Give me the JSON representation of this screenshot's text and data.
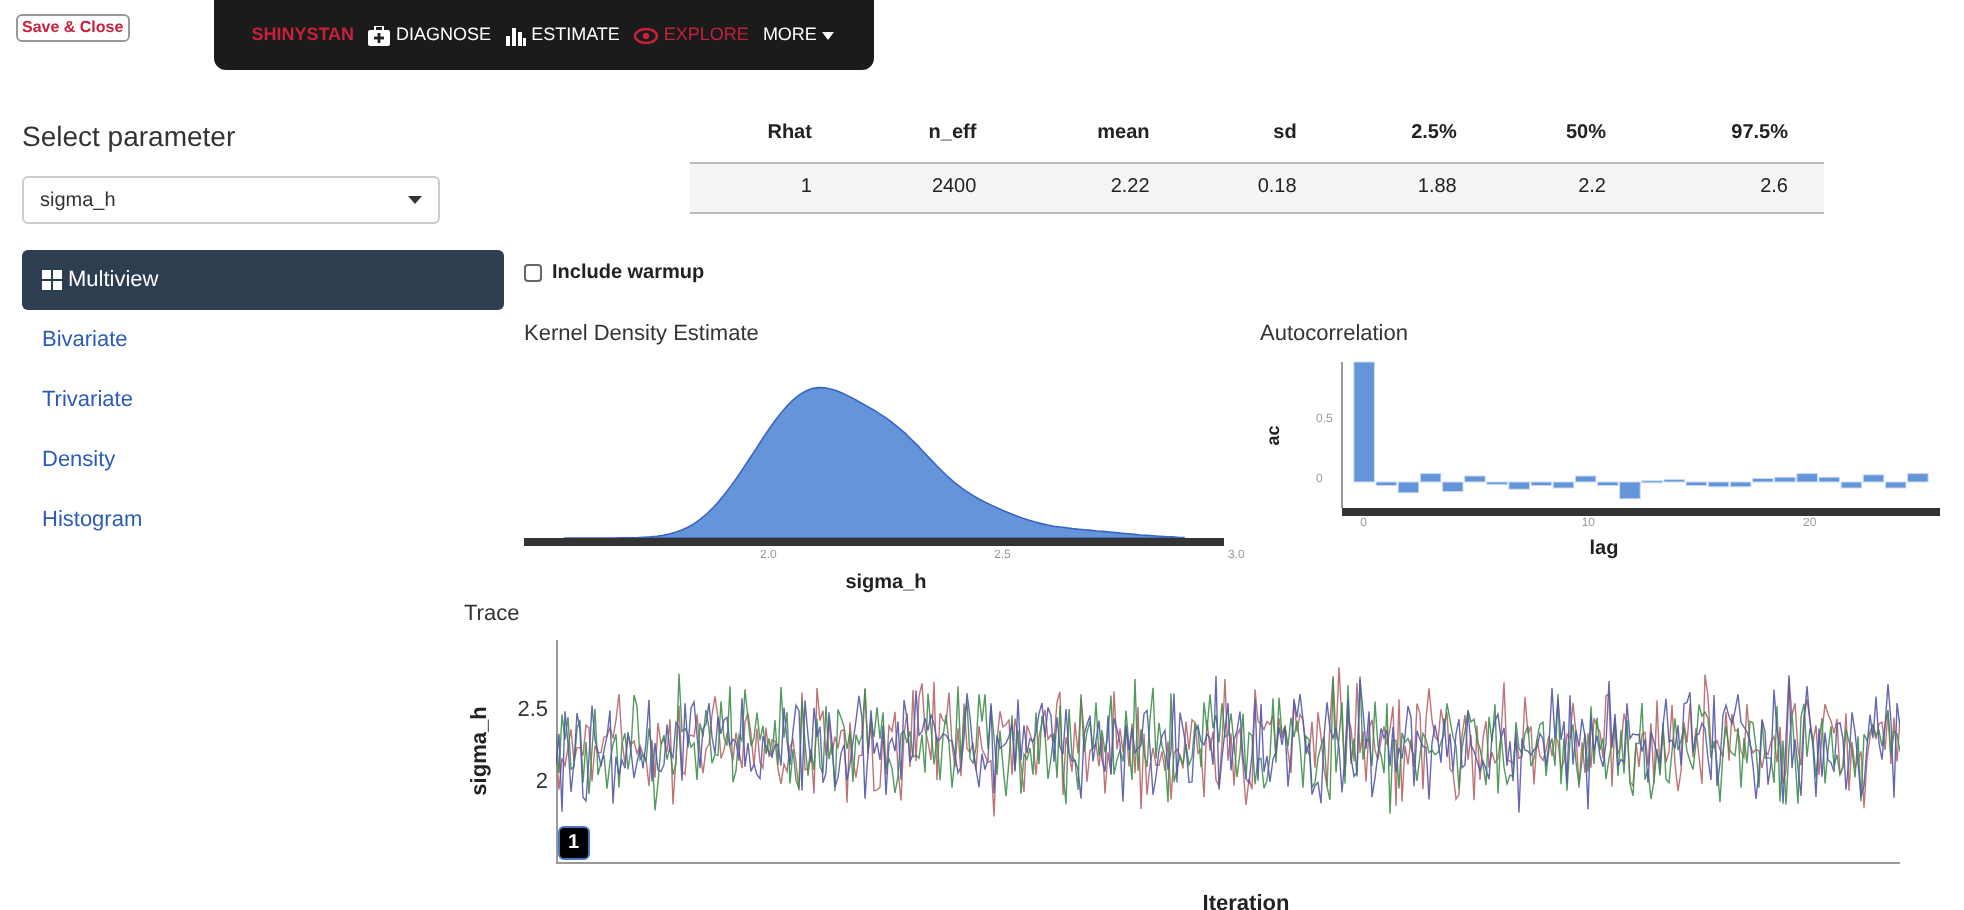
{
  "save_button": "Save & Close",
  "navbar": {
    "brand": "SHINYSTAN",
    "items": [
      {
        "label": "DIAGNOSE",
        "kind": "diagnose",
        "selected": false
      },
      {
        "label": "ESTIMATE",
        "kind": "estimate",
        "selected": false
      },
      {
        "label": "EXPLORE",
        "kind": "explore",
        "selected": true
      },
      {
        "label": "MORE",
        "kind": "more",
        "selected": false
      }
    ]
  },
  "sidebar": {
    "title": "Select parameter",
    "select_value": "sigma_h",
    "items": [
      {
        "label": "Multiview",
        "selected": true
      },
      {
        "label": "Bivariate",
        "selected": false
      },
      {
        "label": "Trivariate",
        "selected": false
      },
      {
        "label": "Density",
        "selected": false
      },
      {
        "label": "Histogram",
        "selected": false
      }
    ]
  },
  "table": {
    "columns": [
      "Rhat",
      "n_eff",
      "mean",
      "sd",
      "2.5%",
      "50%",
      "97.5%"
    ],
    "rows": [
      [
        "1",
        "2400",
        "2.22",
        "0.18",
        "1.88",
        "2.2",
        "2.6"
      ]
    ]
  },
  "include_warmup": {
    "label": "Include warmup",
    "checked": false
  },
  "density": {
    "title": "Kernel Density Estimate",
    "xlabel": "sigma_h",
    "xticks": [
      "2.0",
      "2.5",
      "3.0"
    ]
  },
  "autocorrelation": {
    "title": "Autocorrelation",
    "chart_data": {
      "type": "bar",
      "xlabel": "lag",
      "ylabel": "ac",
      "x": [
        0,
        1,
        2,
        3,
        4,
        5,
        6,
        7,
        8,
        9,
        10,
        11,
        12,
        13,
        14,
        15,
        16,
        17,
        18,
        19,
        20,
        21,
        22,
        23,
        24,
        25
      ],
      "values": [
        1,
        -0.03,
        -0.09,
        0.07,
        -0.08,
        0.05,
        -0.02,
        -0.06,
        -0.03,
        -0.05,
        0.05,
        -0.03,
        -0.14,
        0.01,
        0.02,
        -0.03,
        -0.04,
        -0.04,
        0.03,
        0.04,
        0.07,
        0.04,
        -0.05,
        0.06,
        -0.05,
        0.07
      ],
      "xticks": [
        0,
        10,
        20
      ],
      "yticks": [
        0,
        0.5
      ],
      "xlim": [
        -1,
        26
      ],
      "ylim": [
        -0.2,
        1
      ]
    }
  },
  "trace": {
    "title": "Trace",
    "ylabel": "sigma_h",
    "xlabel": "Iteration",
    "yticks": [
      "2.5",
      "2"
    ],
    "chain_badge": "1"
  }
}
